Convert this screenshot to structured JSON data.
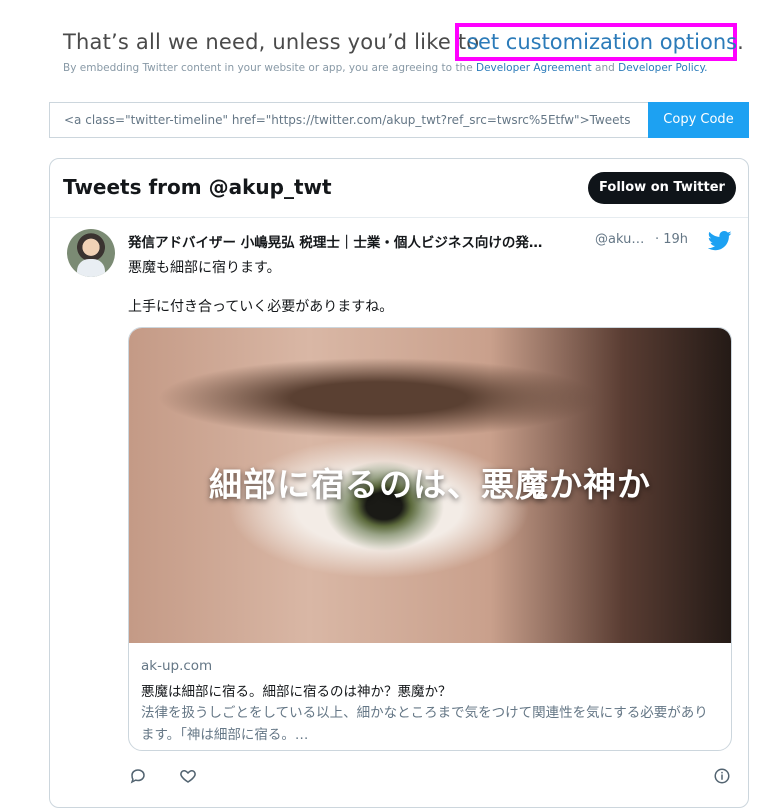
{
  "header": {
    "intro_text": "That’s all we need, unless you’d like to",
    "customization_link": "set customization options",
    "period": ".",
    "disclaimer_prefix": "By embedding Twitter content in your website or app, you are agreeing to the",
    "developer_agreement": "Developer Agreement",
    "and_text": "and",
    "developer_policy": "Developer Policy."
  },
  "embed": {
    "code_value": "<a class=\"twitter-timeline\" href=\"https://twitter.com/akup_twt?ref_src=twsrc%5Etfw\">Tweets by akup_twt</a>",
    "copy_label": "Copy Code"
  },
  "timeline": {
    "title": "Tweets from @akup_twt",
    "follow_label": "Follow on Twitter",
    "tweet": {
      "author_name": "発信アドバイザー 小嶋晃弘 税理士｜士業・個人ビジネス向けの発…",
      "handle": "@aku…",
      "time": "· 19h",
      "text_line1": "悪魔も細部に宿ります。",
      "text_line2": "上手に付き合っていく必要がありますね。",
      "card": {
        "image_text": "細部に宿るのは、悪魔か神か",
        "domain": "ak-up.com",
        "title": "悪魔は細部に宿る。細部に宿るのは神か？悪魔か？",
        "description": "法律を扱うしごとをしている以上、細かなところまで気をつけて関連性を気にする必要があります。「神は細部に宿る。…"
      }
    }
  },
  "colors": {
    "link": "#2b7bb9",
    "twitter_blue": "#1da1f2",
    "highlight_box": "#ff00ff",
    "follow_button": "#0f1419"
  },
  "icons": [
    "twitter-bird-icon",
    "reply-icon",
    "like-icon",
    "info-icon"
  ]
}
